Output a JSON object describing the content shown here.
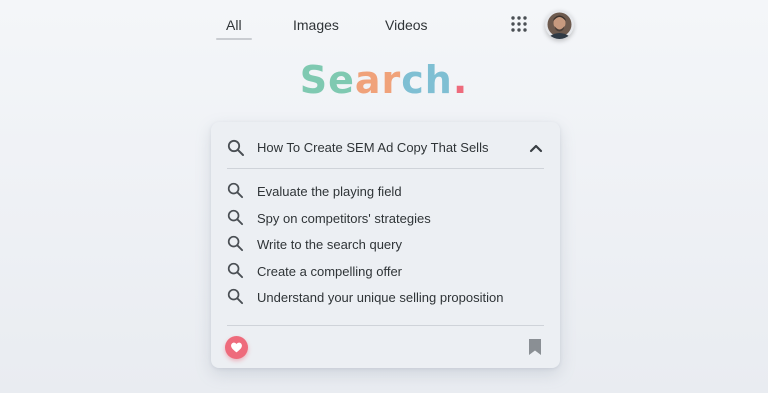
{
  "nav": {
    "tabs": [
      {
        "label": "All",
        "active": true
      },
      {
        "label": "Images",
        "active": false
      },
      {
        "label": "Videos",
        "active": false
      }
    ],
    "apps_icon": "grid-icon",
    "avatar_icon": "user-avatar"
  },
  "logo": {
    "letters": [
      "S",
      "e",
      "a",
      "r",
      "c",
      "h",
      "."
    ],
    "colors": [
      "#7fc9b1",
      "#7fc9b1",
      "#f0a27a",
      "#f0a27a",
      "#7fbfd3",
      "#7fbfd3",
      "#ee6b7c"
    ]
  },
  "search": {
    "query": "How To Create SEM Ad Copy That Sells",
    "suggestions": [
      "Evaluate the playing field",
      "Spy on competitors' strategies",
      "Write to the search query",
      "Create a compelling offer",
      "Understand your unique selling proposition"
    ],
    "collapse_icon": "chevron-up-icon"
  },
  "footer": {
    "like_icon": "heart-icon",
    "bookmark_icon": "bookmark-icon"
  },
  "colors": {
    "background": "#eef0f4",
    "card": "#eceff3",
    "heart": "#ee6b7c",
    "bookmark": "#8a8f94"
  }
}
